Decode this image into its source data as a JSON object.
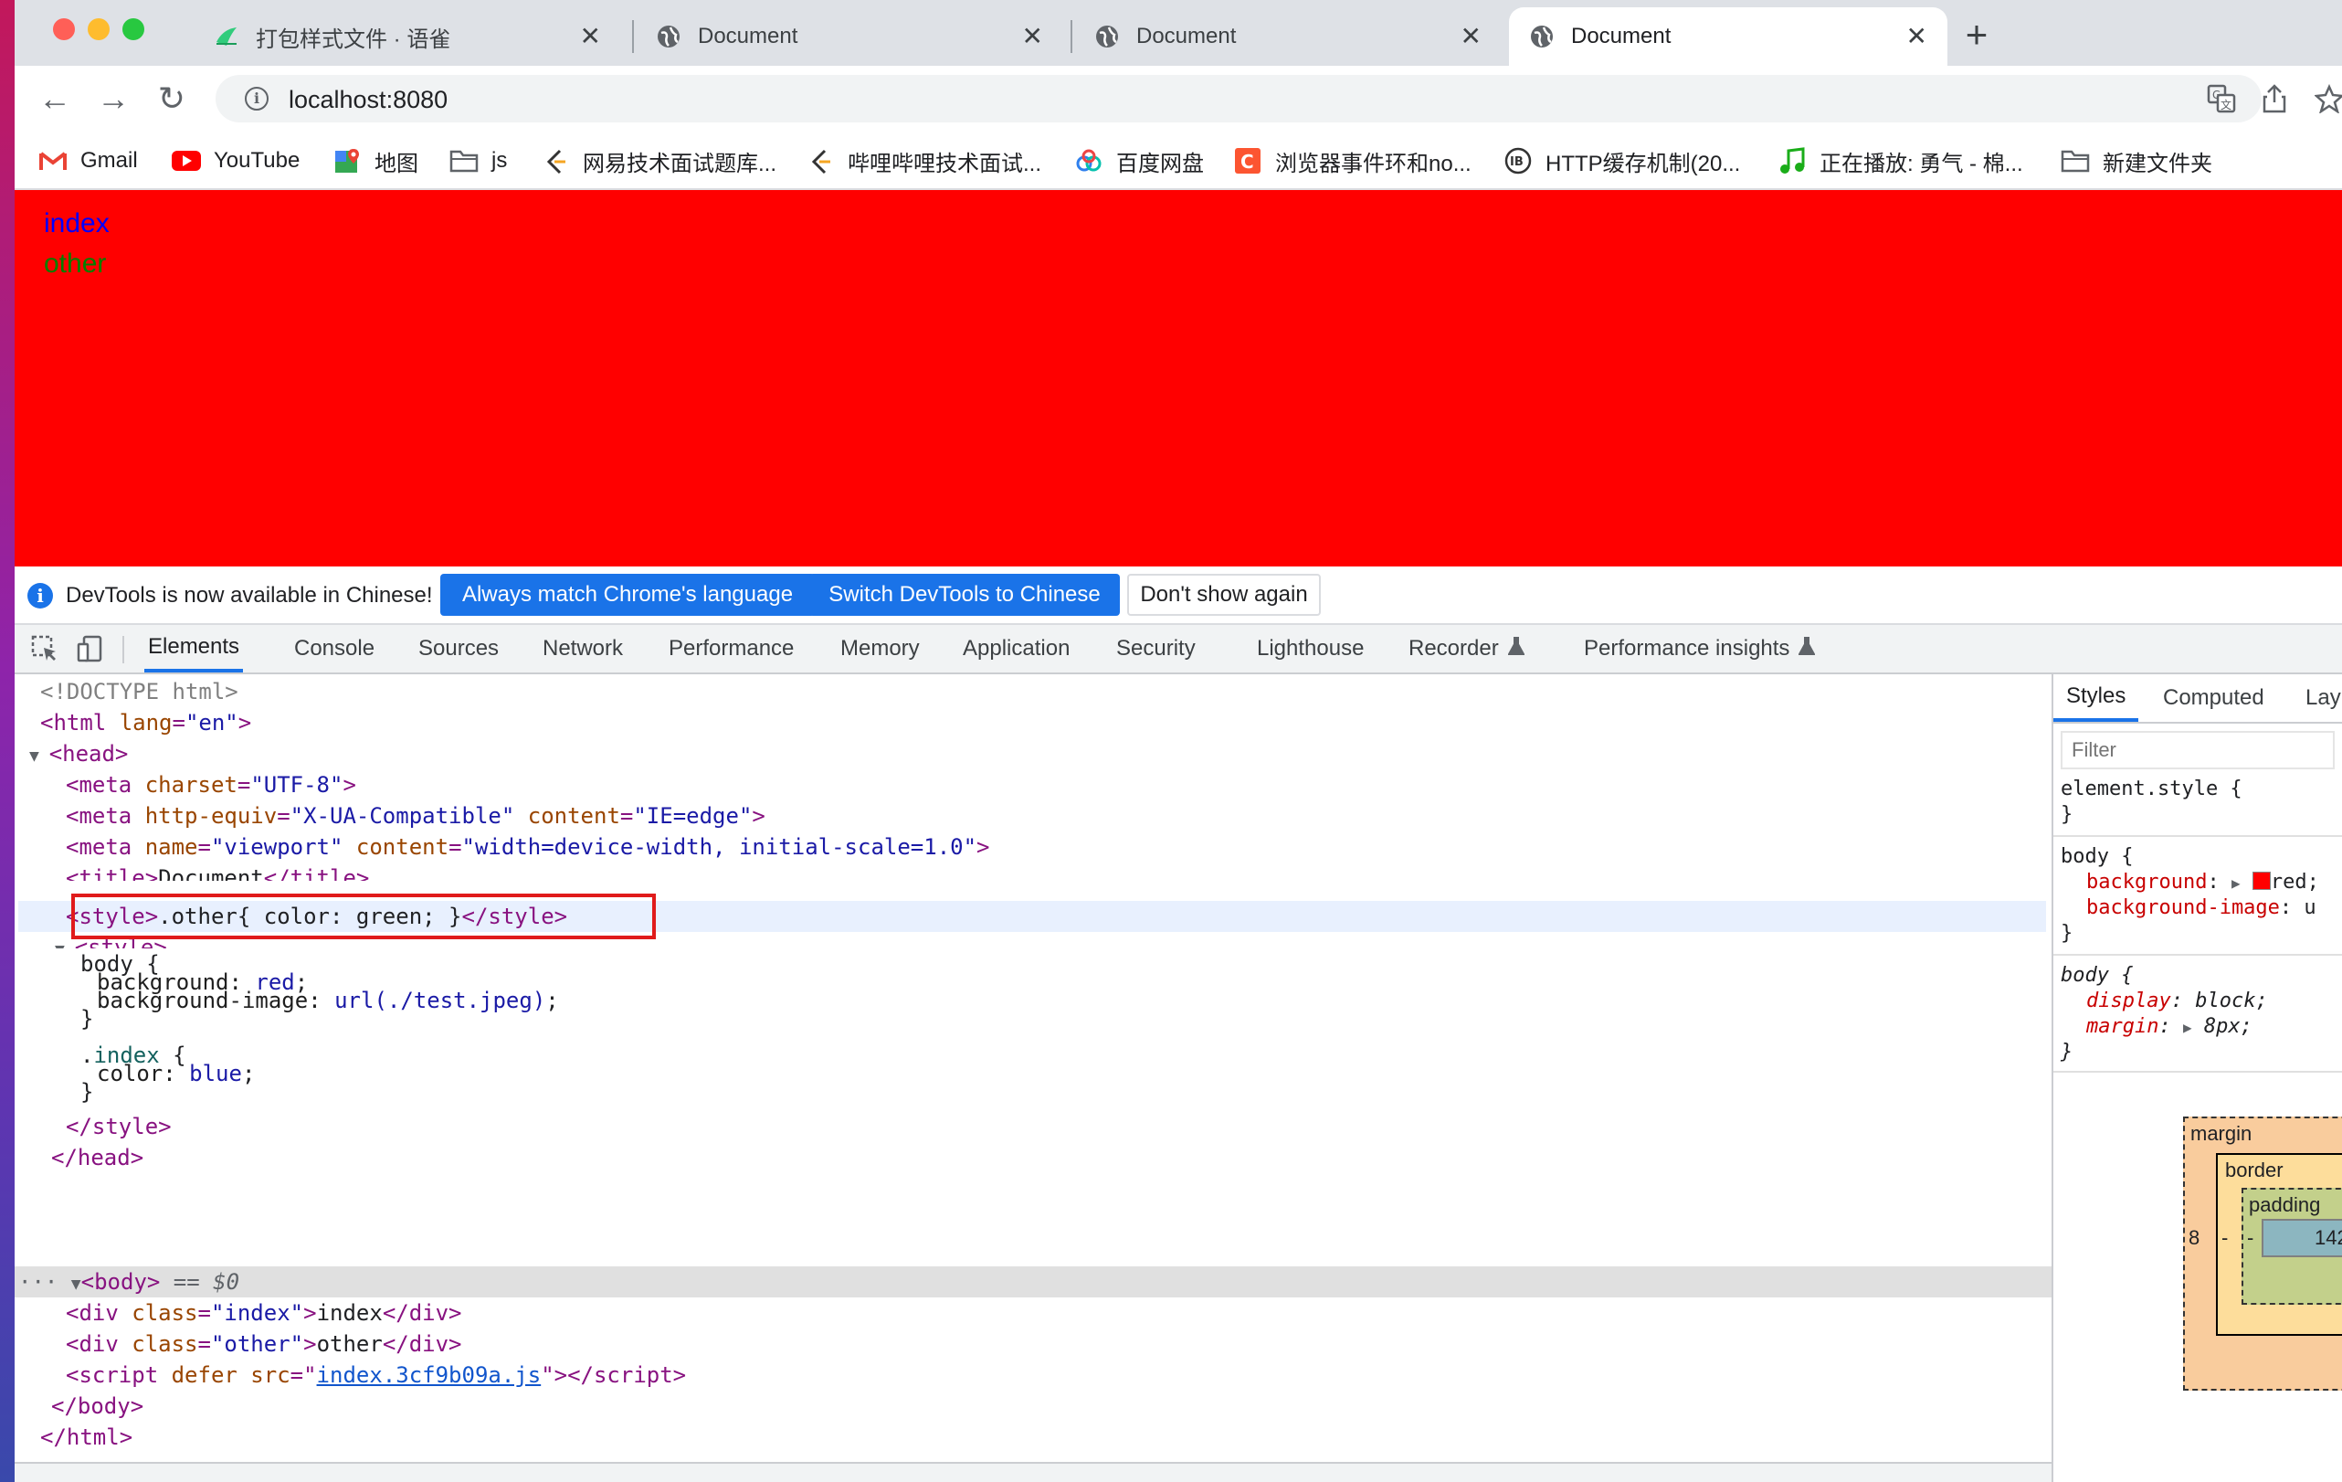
{
  "tabs": [
    {
      "title": "打包样式文件 · 语雀",
      "icon": "yuque-icon",
      "close": "✕"
    },
    {
      "title": "Document",
      "icon": "globe-icon",
      "close": "✕"
    },
    {
      "title": "Document",
      "icon": "globe-icon",
      "close": "✕"
    },
    {
      "title": "Document",
      "icon": "globe-icon",
      "close": "✕",
      "active": true
    }
  ],
  "new_tab_symbol": "+",
  "toolbar": {
    "back": "←",
    "forward": "→",
    "reload": "↻",
    "url": "localhost:8080",
    "info_symbol": "i"
  },
  "bookmarks": [
    {
      "label": "Gmail",
      "icon": "gmail-icon"
    },
    {
      "label": "YouTube",
      "icon": "youtube-icon"
    },
    {
      "label": "地图",
      "icon": "maps-icon"
    },
    {
      "label": "js",
      "icon": "folder-icon"
    },
    {
      "label": "网易技术面试题库...",
      "icon": "site-icon"
    },
    {
      "label": "哔哩哔哩技术面试...",
      "icon": "site-icon"
    },
    {
      "label": "百度网盘",
      "icon": "baidu-pan-icon"
    },
    {
      "label": "浏览器事件环和no...",
      "icon": "csdn-icon"
    },
    {
      "label": "HTTP缓存机制(20...",
      "icon": "site-icon"
    },
    {
      "label": "正在播放: 勇气 - 棉...",
      "icon": "music-icon"
    },
    {
      "label": "新建文件夹",
      "icon": "folder-icon"
    }
  ],
  "page": {
    "background": "#ff0000",
    "lines": [
      {
        "text": "index",
        "color": "#0000ff"
      },
      {
        "text": "other",
        "color": "#008000"
      }
    ]
  },
  "infobar": {
    "message": "DevTools is now available in Chinese!",
    "buttons": [
      "Always match Chrome's language",
      "Switch DevTools to Chinese",
      "Don't show again"
    ]
  },
  "devtools": {
    "tabs": [
      "Elements",
      "Console",
      "Sources",
      "Network",
      "Performance",
      "Memory",
      "Application",
      "Security",
      "Lighthouse",
      "Recorder",
      "Performance insights"
    ],
    "active_tab": "Elements",
    "dom": {
      "doctype": "<!DOCTYPE html>",
      "html_open": "<html",
      "lang_attr": "lang",
      "lang_val": "\"en\"",
      "head_open": "<head>",
      "meta1": {
        "attr": "charset",
        "val": "\"UTF-8\""
      },
      "meta2": {
        "attr1": "http-equiv",
        "val1": "\"X-UA-Compatible\"",
        "attr2": "content",
        "val2": "\"IE=edge\""
      },
      "meta3": {
        "attr1": "name",
        "val1": "\"viewport\"",
        "attr2": "content",
        "val2": "\"width=device-width, initial-scale=1.0\""
      },
      "title_line": "Document",
      "style_inline_open": "<style>",
      "style_inline_css": ".other{ color: green; }",
      "style_inline_close": "</style>",
      "style_open": "<style>",
      "css": [
        "body {",
        "background: red;",
        "background-image: url(./test.jpeg);",
        "}",
        ".index {",
        "color: blue;",
        "}"
      ],
      "style_close": "</style>",
      "head_close": "</head>",
      "body_open": "<body>",
      "body_marker": "== $0",
      "div1": {
        "cls": "\"index\"",
        "text": "index"
      },
      "div2": {
        "cls": "\"other\"",
        "text": "other"
      },
      "script_src": "index.3cf9b09a.js",
      "body_close": "</body>",
      "html_close": "</html>"
    }
  },
  "styles_panel": {
    "tabs": [
      "Styles",
      "Computed",
      "Lay"
    ],
    "filter_placeholder": "Filter",
    "element_style": "element.style {",
    "body_rule1": {
      "selector": "body {",
      "prop1": "background",
      "val1": "red;",
      "prop2": "background-image",
      "val2": "u"
    },
    "body_rule2": {
      "selector": "body {",
      "prop1": "display",
      "val1": "block;",
      "prop2": "margin",
      "val2": "8px;"
    },
    "box_model": {
      "margin": "margin",
      "border": "border",
      "padding": "padding",
      "content": "142",
      "margin_left": "8",
      "dash": "-"
    }
  }
}
